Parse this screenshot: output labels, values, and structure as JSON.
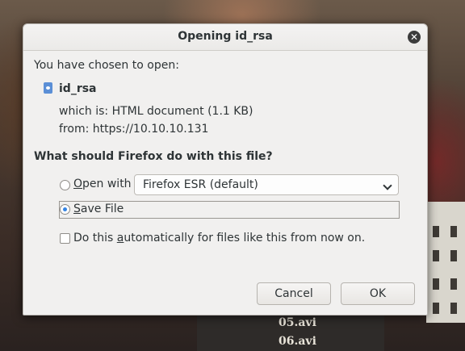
{
  "background": {
    "files": [
      "05.avi",
      "06.avi"
    ]
  },
  "dialog": {
    "title": "Opening id_rsa",
    "close_icon": "close-icon",
    "intro": "You have chosen to open:",
    "file_icon": "html-file-icon",
    "filename": "id_rsa",
    "which_is": "which is:  HTML document (1.1 KB)",
    "from": "from:  https://10.10.10.131",
    "question": "What should Firefox do with this file?",
    "open_with": {
      "mnemonic": "O",
      "label_rest": "pen with",
      "selected": false,
      "app": "Firefox ESR (default)"
    },
    "save_file": {
      "mnemonic": "S",
      "label_rest": "ave File",
      "selected": true
    },
    "auto": {
      "label_pre": "Do this ",
      "mnemonic": "a",
      "label_post": "utomatically for files like this from now on.",
      "checked": false
    },
    "cancel_label": "Cancel",
    "ok_label": "OK"
  }
}
